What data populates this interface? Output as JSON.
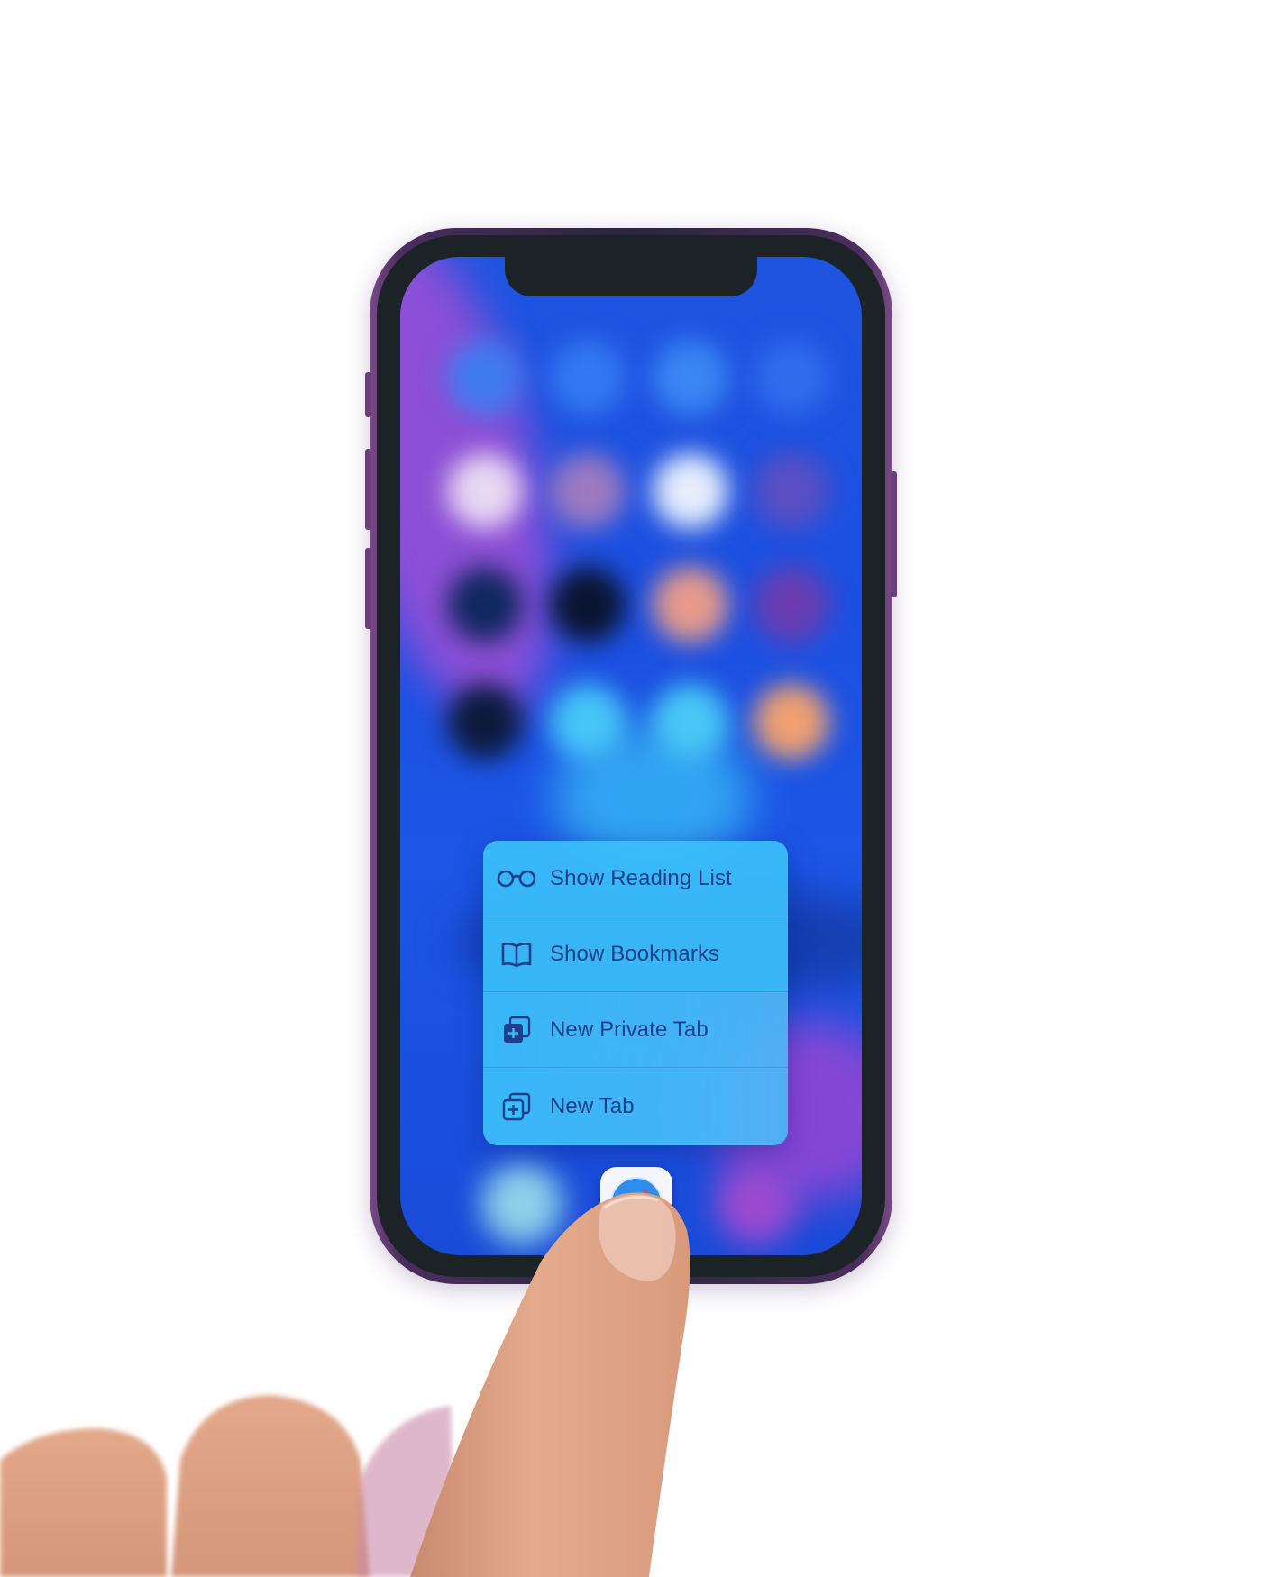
{
  "quick_actions": {
    "items": [
      {
        "label": "Show Reading List",
        "icon": "glasses-icon"
      },
      {
        "label": "Show Bookmarks",
        "icon": "book-icon"
      },
      {
        "label": "New Private Tab",
        "icon": "private-tab-icon"
      },
      {
        "label": "New Tab",
        "icon": "new-tab-icon"
      }
    ]
  },
  "dock": {
    "app": "Safari",
    "icon": "safari-compass-icon"
  },
  "colors": {
    "menu_background": "#3abefa",
    "menu_text": "#1f3f8c",
    "wallpaper_blue": "#1d4fe0",
    "wallpaper_purple": "#9a4fd6",
    "phone_frame": "#6d3d7d",
    "finger_skin": "#e3a88a"
  }
}
